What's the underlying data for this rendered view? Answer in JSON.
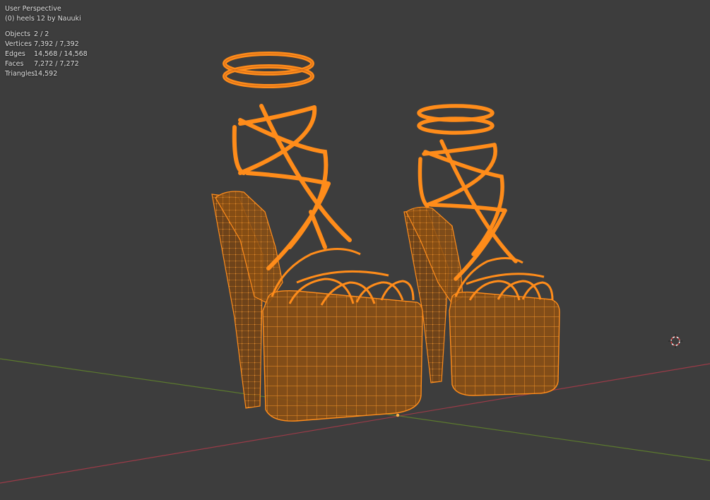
{
  "overlay": {
    "perspective": "User Perspective",
    "collection": "(0) heels 12 by Nauuki"
  },
  "stats": [
    {
      "label": "Objects",
      "value": "2 / 2"
    },
    {
      "label": "Vertices",
      "value": "7,392 / 7,392"
    },
    {
      "label": "Edges",
      "value": "14,568 / 14,568"
    },
    {
      "label": "Faces",
      "value": "7,272 / 7,272"
    },
    {
      "label": "Triangles",
      "value": "14,592"
    }
  ],
  "colors": {
    "background": "#3d3d3d",
    "mesh_wire": "#ff8c1a",
    "mesh_fill": "#8a4f14",
    "x_axis": "#9b3b48",
    "y_axis": "#5c7a2e"
  },
  "icons": {
    "cursor": "3d-cursor-icon"
  }
}
